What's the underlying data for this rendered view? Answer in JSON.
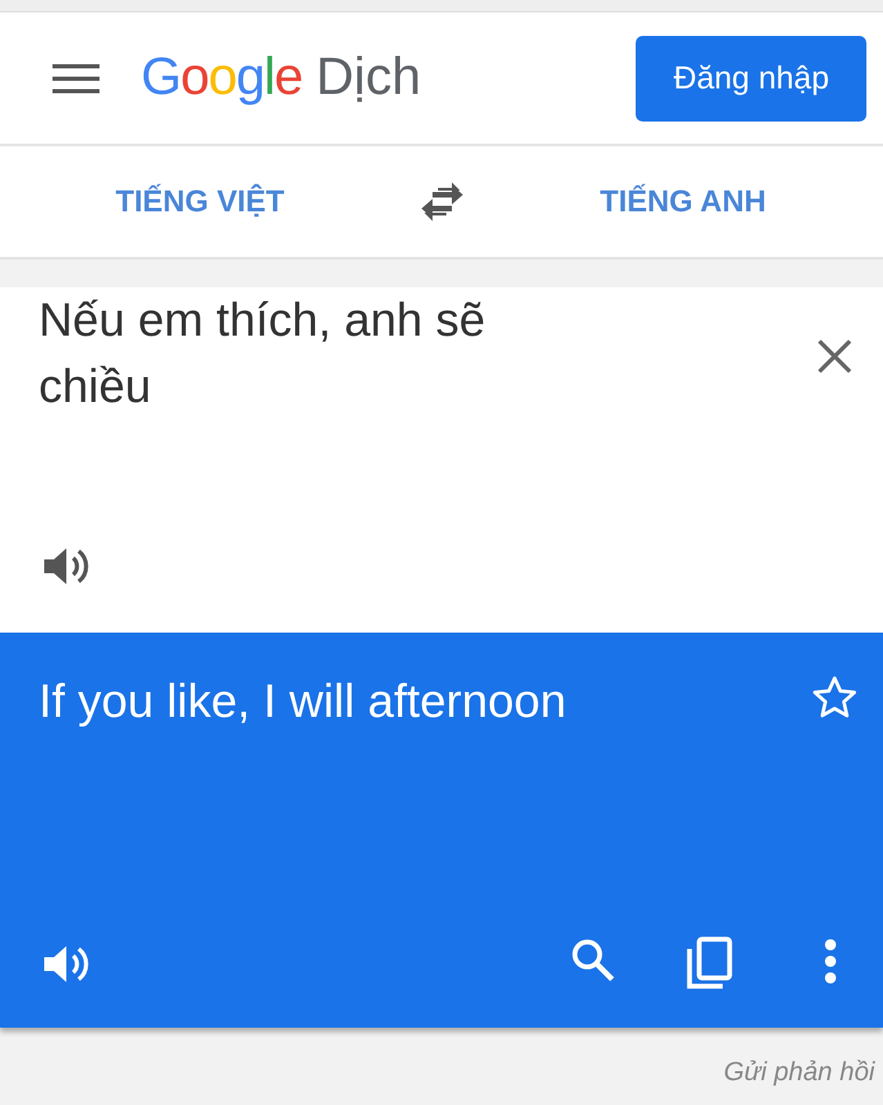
{
  "header": {
    "logo": "Google",
    "product": "Dịch",
    "sign_in": "Đăng nhập"
  },
  "languages": {
    "source": "TIẾNG VIỆT",
    "target": "TIẾNG ANH"
  },
  "input": {
    "value": "Nếu em thích, anh sẽ chiều"
  },
  "output": {
    "text": "If you like, I will afternoon",
    "starred": false
  },
  "feedback": "Gửi phản hồi"
}
